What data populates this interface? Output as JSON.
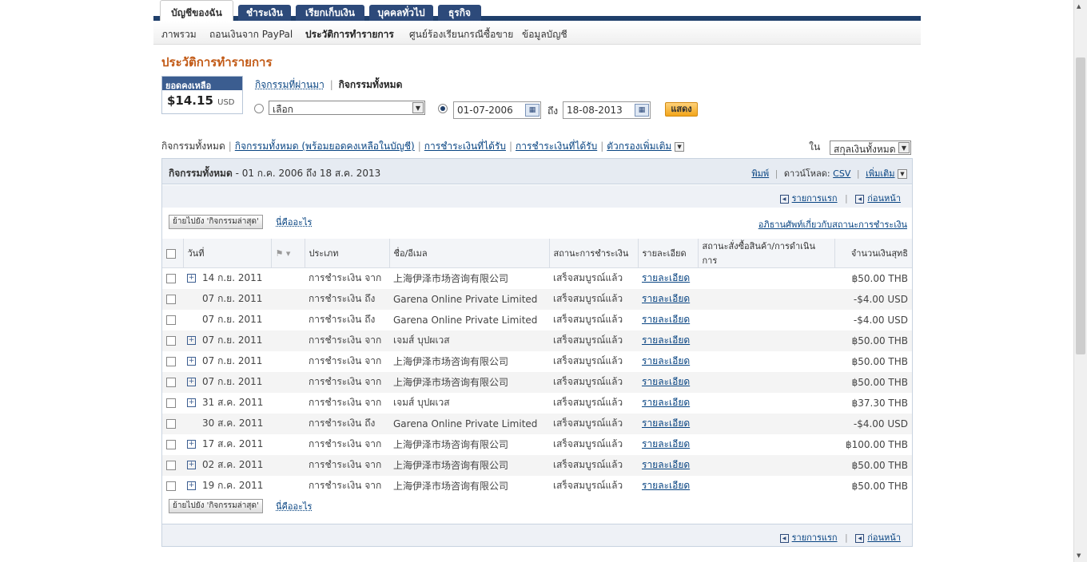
{
  "tabs": [
    {
      "label": "บัญชีของฉัน",
      "active": true
    },
    {
      "label": "ชำระเงิน",
      "active": false
    },
    {
      "label": "เรียกเก็บเงิน",
      "active": false
    },
    {
      "label": "บุคคลทั่วไป",
      "active": false
    },
    {
      "label": "ธุรกิจ",
      "active": false
    }
  ],
  "subnav": [
    "ภาพรวม",
    "ถอนเงินจาก PayPal",
    "ประวัติการทำรายการ",
    "ศูนย์ร้องเรียนกรณีซื้อขาย",
    "ข้อมูลบัญชี"
  ],
  "page_title": "ประวัติการทำรายการ",
  "balance": {
    "label": "ยอดคงเหลือ",
    "amount": "$14.15",
    "currency": "USD"
  },
  "modes": {
    "recent": "กิจกรรมที่ผ่านมา",
    "all": "กิจกรรมทั้งหมด"
  },
  "filter": {
    "select_value": "เลือก",
    "date_from": "01-07-2006",
    "to_label": "ถึง",
    "date_to": "18-08-2013",
    "show_button": "แสดง"
  },
  "filter_links": {
    "current": "กิจกรรมทั้งหมด",
    "with_balance": "กิจกรรมทั้งหมด (พร้อมยอดคงเหลือในบัญชี)",
    "payments_received": "การชำระเงินที่ได้รับ",
    "payments_sent": "การชำระเงินที่ได้รับ",
    "more_filters": "ตัวกรองเพิ่มเติม"
  },
  "currency_filter": {
    "label": "ใน",
    "value": "สกุลเงินทั้งหมด"
  },
  "panel": {
    "title": "กิจกรรมทั้งหมด",
    "range": "- 01 ก.ค. 2006 ถึง 18 ส.ค. 2013",
    "print": "พิมพ์",
    "download_label": "ดาวน์โหลด:",
    "download_csv": "CSV",
    "more": "เพิ่มเติม",
    "pager_first": "รายการแรก",
    "pager_prev": "ก่อนหน้า",
    "move_button": "ย้ายไปยัง 'กิจกรรมล่าสุด'",
    "what_is": "นี่คืออะไร",
    "status_glossary": "อภิธานศัพท์เกี่ยวกับสถานะการชำระเงิน"
  },
  "columns": [
    "วันที่",
    "",
    "ประเภท",
    "ชื่อ/อีเมล",
    "สถานะการชำระเงิน",
    "รายละเอียด",
    "สถานะสั่งซื้อสินค้า/การดำเนินการ",
    "จำนวนเงินสุทธิ"
  ],
  "rows": [
    {
      "expand": true,
      "date": "14 ก.ย. 2011",
      "type": "การชำระเงิน จาก",
      "name": "上海伊泽市场咨询有限公司",
      "status": "เสร็จสมบูรณ์แล้ว",
      "details": "รายละเอียด",
      "amount": "฿50.00 THB"
    },
    {
      "expand": false,
      "date": "07 ก.ย. 2011",
      "type": "การชำระเงิน ถึง",
      "name": "Garena Online Private Limited",
      "status": "เสร็จสมบูรณ์แล้ว",
      "details": "รายละเอียด",
      "amount": "-$4.00 USD"
    },
    {
      "expand": false,
      "date": "07 ก.ย. 2011",
      "type": "การชำระเงิน ถึง",
      "name": "Garena Online Private Limited",
      "status": "เสร็จสมบูรณ์แล้ว",
      "details": "รายละเอียด",
      "amount": "-$4.00 USD"
    },
    {
      "expand": true,
      "date": "07 ก.ย. 2011",
      "type": "การชำระเงิน จาก",
      "name": "เจมส์ บุปผเวส",
      "status": "เสร็จสมบูรณ์แล้ว",
      "details": "รายละเอียด",
      "amount": "฿50.00 THB"
    },
    {
      "expand": true,
      "date": "07 ก.ย. 2011",
      "type": "การชำระเงิน จาก",
      "name": "上海伊泽市场咨询有限公司",
      "status": "เสร็จสมบูรณ์แล้ว",
      "details": "รายละเอียด",
      "amount": "฿50.00 THB"
    },
    {
      "expand": true,
      "date": "07 ก.ย. 2011",
      "type": "การชำระเงิน จาก",
      "name": "上海伊泽市场咨询有限公司",
      "status": "เสร็จสมบูรณ์แล้ว",
      "details": "รายละเอียด",
      "amount": "฿50.00 THB"
    },
    {
      "expand": true,
      "date": "31 ส.ค. 2011",
      "type": "การชำระเงิน จาก",
      "name": "เจมส์ บุปผเวส",
      "status": "เสร็จสมบูรณ์แล้ว",
      "details": "รายละเอียด",
      "amount": "฿37.30 THB"
    },
    {
      "expand": false,
      "date": "30 ส.ค. 2011",
      "type": "การชำระเงิน ถึง",
      "name": "Garena Online Private Limited",
      "status": "เสร็จสมบูรณ์แล้ว",
      "details": "รายละเอียด",
      "amount": "-$4.00 USD"
    },
    {
      "expand": true,
      "date": "17 ส.ค. 2011",
      "type": "การชำระเงิน จาก",
      "name": "上海伊泽市场咨询有限公司",
      "status": "เสร็จสมบูรณ์แล้ว",
      "details": "รายละเอียด",
      "amount": "฿100.00 THB"
    },
    {
      "expand": true,
      "date": "02 ส.ค. 2011",
      "type": "การชำระเงิน จาก",
      "name": "上海伊泽市场咨询有限公司",
      "status": "เสร็จสมบูรณ์แล้ว",
      "details": "รายละเอียด",
      "amount": "฿50.00 THB"
    },
    {
      "expand": true,
      "date": "19 ก.ค. 2011",
      "type": "การชำระเงิน จาก",
      "name": "上海伊泽市场咨询有限公司",
      "status": "เสร็จสมบูรณ์แล้ว",
      "details": "รายละเอียด",
      "amount": "฿50.00 THB"
    }
  ],
  "icons": {
    "expand": "plus-box-icon",
    "flag": "flag-icon",
    "calendar": "calendar-icon",
    "pager": "arrow-left-box-icon"
  }
}
